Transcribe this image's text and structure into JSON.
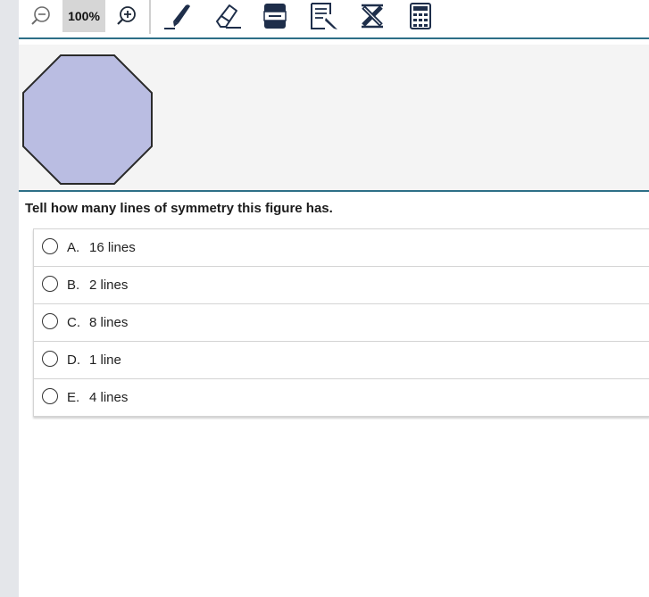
{
  "toolbar": {
    "zoom_out_icon": "zoom-out-icon",
    "zoom_level": "100%",
    "zoom_in_icon": "zoom-in-icon",
    "tools": [
      "highlighter-icon",
      "eraser-icon",
      "line-reader-icon",
      "notepad-icon",
      "answer-eliminator-icon",
      "calculator-icon"
    ]
  },
  "stimulus": {
    "shape": "octagon",
    "fill_color": "#babde2",
    "stroke_color": "#2a2a2a"
  },
  "question": {
    "text": "Tell how many lines of symmetry this figure has."
  },
  "options": [
    {
      "letter": "A.",
      "text": "16 lines"
    },
    {
      "letter": "B.",
      "text": "2 lines"
    },
    {
      "letter": "C.",
      "text": "8 lines"
    },
    {
      "letter": "D.",
      "text": "1 line"
    },
    {
      "letter": "E.",
      "text": "4 lines"
    }
  ],
  "colors": {
    "accent": "#2d6f87",
    "gutter": "#e4e6ea",
    "stimulus_bg": "#f4f4f4",
    "zoom_bg": "#d6d6d6"
  }
}
